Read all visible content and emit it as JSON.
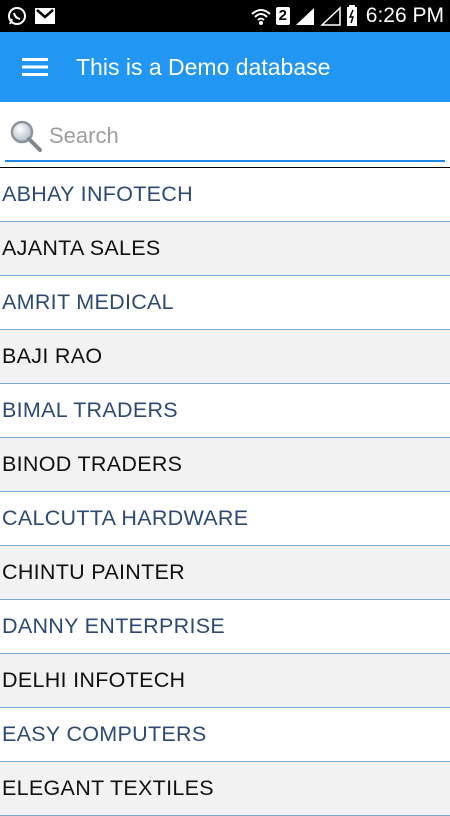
{
  "status_bar": {
    "time": "6:26 PM",
    "sim": "2"
  },
  "app_bar": {
    "title": "This is a Demo database"
  },
  "search": {
    "placeholder": "Search"
  },
  "list": {
    "items": [
      "ABHAY INFOTECH",
      "AJANTA SALES",
      "AMRIT MEDICAL",
      "BAJI RAO",
      "BIMAL TRADERS",
      "BINOD TRADERS",
      "CALCUTTA HARDWARE",
      "CHINTU PAINTER",
      "DANNY ENTERPRISE",
      "DELHI INFOTECH",
      "EASY COMPUTERS",
      "ELEGANT TEXTILES"
    ]
  },
  "colors": {
    "app_bar": "#2196f3",
    "odd_text": "#2c4a74",
    "even_bg": "#f2f2f2",
    "divider": "#7aa8d9"
  }
}
